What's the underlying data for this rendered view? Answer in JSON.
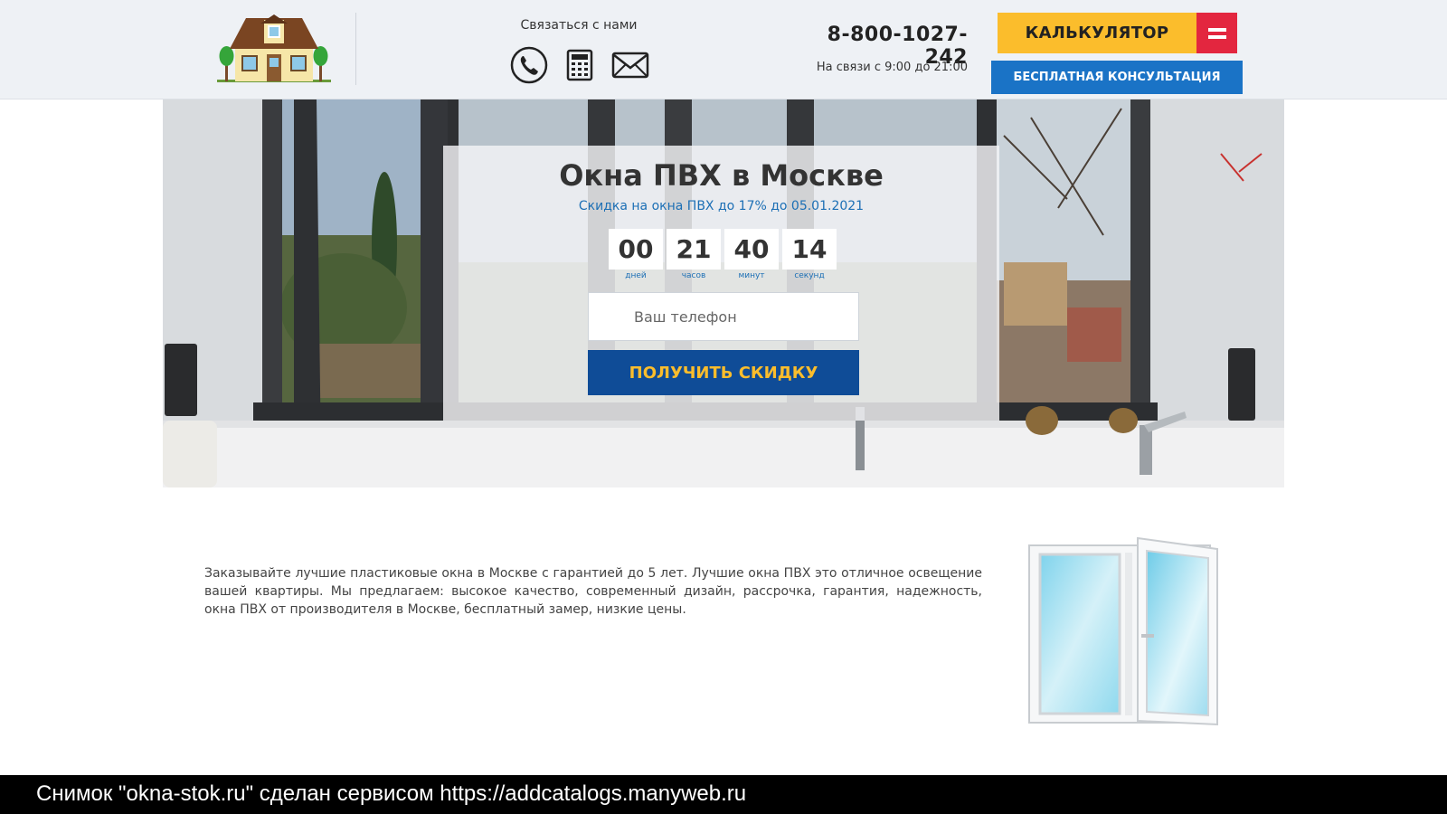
{
  "header": {
    "contact_title": "Связаться с нами",
    "contact_icons": [
      "phone-icon",
      "calculator-icon",
      "envelope-icon"
    ],
    "phone": "8-800-1027-242",
    "hours": "На связи с 9:00 до 21:00",
    "calc_label": "КАЛЬКУЛЯТОР",
    "consult_label": "БЕСПЛАТНАЯ КОНСУЛЬТАЦИЯ"
  },
  "hero": {
    "title": "Окна ПВХ в Москве",
    "subtitle": "Скидка на окна ПВХ до 17% до 05.01.2021",
    "timer": [
      {
        "value": "00",
        "label": "дней"
      },
      {
        "value": "21",
        "label": "часов"
      },
      {
        "value": "40",
        "label": "минут"
      },
      {
        "value": "14",
        "label": "секунд"
      }
    ],
    "phone_placeholder": "Ваш телефон",
    "cta_label": "ПОЛУЧИТЬ СКИДКУ"
  },
  "content": {
    "text": "Заказывайте лучшие пластиковые окна в Москве с гарантией до 5 лет. Лучшие окна ПВХ это отличное освещение вашей квартиры. Мы предлагаем: высокое качество, современный дизайн, рассрочка, гарантия, надежность, окна ПВХ от производителя в Москве, бесплатный замер, низкие цены."
  },
  "footer": {
    "text": "Снимок \"okna-stok.ru\" сделан сервисом https://addcatalogs.manyweb.ru"
  },
  "colors": {
    "calc_yellow": "#fbbd2c",
    "calc_red": "#e3263f",
    "consult_blue": "#1a73c6",
    "cta_navy": "#0f4c97",
    "accent_text_blue": "#1c6fb5"
  }
}
